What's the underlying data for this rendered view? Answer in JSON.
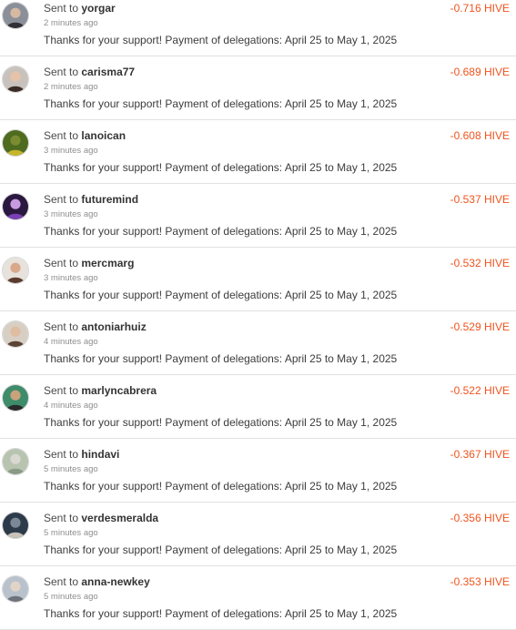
{
  "colors": {
    "amount": "#f0541e",
    "divider": "#e1e1e1"
  },
  "transactions": [
    {
      "prefix": "Sent to",
      "username": "yorgar",
      "time": "2 minutes ago",
      "memo": "Thanks for your support! Payment of delegations: April 25 to May 1, 2025",
      "amount": "-0.716 HIVE",
      "avatar_icon": "user-avatar-icon"
    },
    {
      "prefix": "Sent to",
      "username": "carisma77",
      "time": "2 minutes ago",
      "memo": "Thanks for your support! Payment of delegations: April 25 to May 1, 2025",
      "amount": "-0.689 HIVE",
      "avatar_icon": "user-avatar-icon"
    },
    {
      "prefix": "Sent to",
      "username": "lanoican",
      "time": "3 minutes ago",
      "memo": "Thanks for your support! Payment of delegations: April 25 to May 1, 2025",
      "amount": "-0.608 HIVE",
      "avatar_icon": "user-avatar-icon"
    },
    {
      "prefix": "Sent to",
      "username": "futuremind",
      "time": "3 minutes ago",
      "memo": "Thanks for your support! Payment of delegations: April 25 to May 1, 2025",
      "amount": "-0.537 HIVE",
      "avatar_icon": "user-avatar-icon"
    },
    {
      "prefix": "Sent to",
      "username": "mercmarg",
      "time": "3 minutes ago",
      "memo": "Thanks for your support! Payment of delegations: April 25 to May 1, 2025",
      "amount": "-0.532 HIVE",
      "avatar_icon": "user-avatar-icon"
    },
    {
      "prefix": "Sent to",
      "username": "antoniarhuiz",
      "time": "4 minutes ago",
      "memo": "Thanks for your support! Payment of delegations: April 25 to May 1, 2025",
      "amount": "-0.529 HIVE",
      "avatar_icon": "user-avatar-icon"
    },
    {
      "prefix": "Sent to",
      "username": "marlyncabrera",
      "time": "4 minutes ago",
      "memo": "Thanks for your support! Payment of delegations: April 25 to May 1, 2025",
      "amount": "-0.522 HIVE",
      "avatar_icon": "user-avatar-icon"
    },
    {
      "prefix": "Sent to",
      "username": "hindavi",
      "time": "5 minutes ago",
      "memo": "Thanks for your support! Payment of delegations: April 25 to May 1, 2025",
      "amount": "-0.367 HIVE",
      "avatar_icon": "user-avatar-icon"
    },
    {
      "prefix": "Sent to",
      "username": "verdesmeralda",
      "time": "5 minutes ago",
      "memo": "Thanks for your support! Payment of delegations: April 25 to May 1, 2025",
      "amount": "-0.356 HIVE",
      "avatar_icon": "user-avatar-icon"
    },
    {
      "prefix": "Sent to",
      "username": "anna-newkey",
      "time": "5 minutes ago",
      "memo": "Thanks for your support! Payment of delegations: April 25 to May 1, 2025",
      "amount": "-0.353 HIVE",
      "avatar_icon": "user-avatar-icon"
    }
  ]
}
